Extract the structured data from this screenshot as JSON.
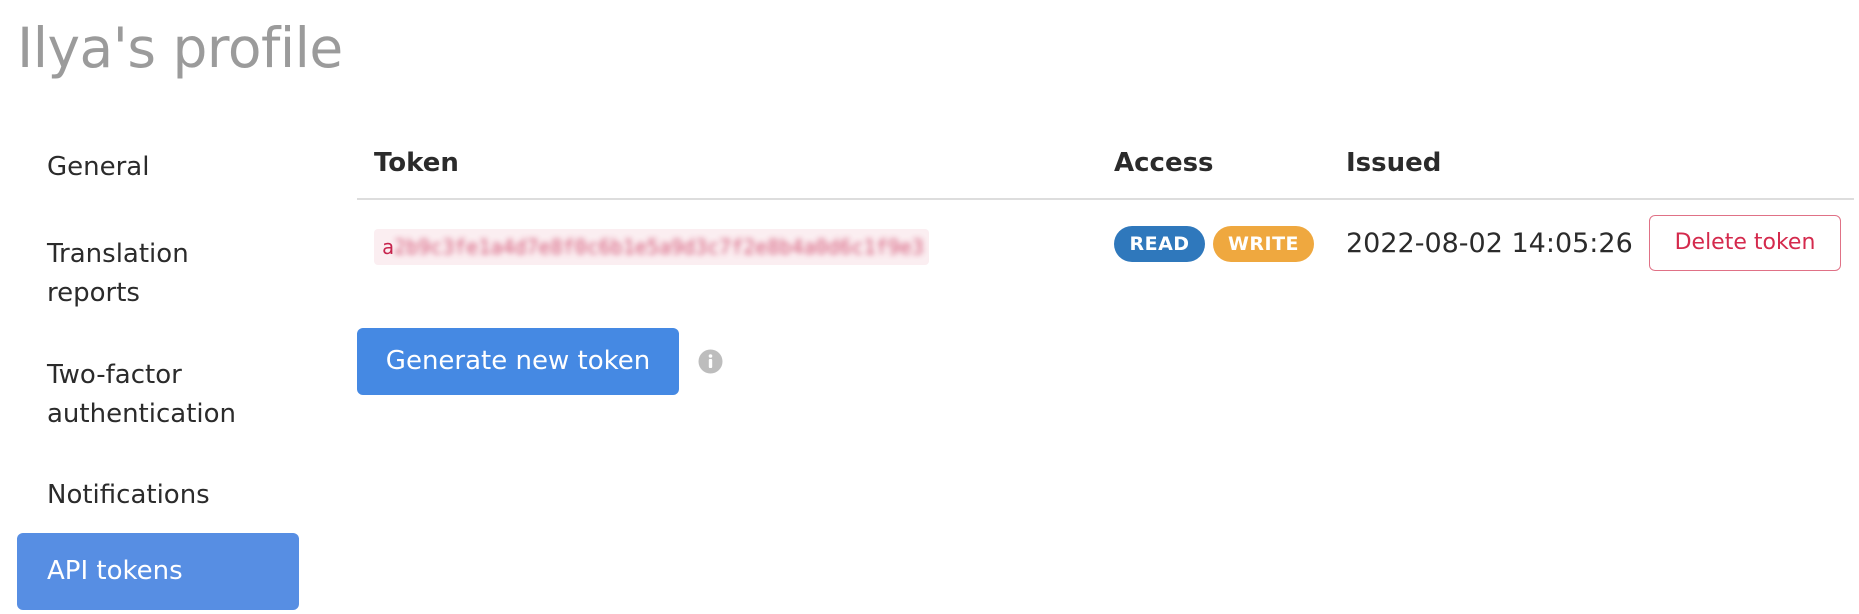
{
  "page": {
    "title": "Ilya's profile"
  },
  "sidebar": {
    "items": [
      {
        "label": "General",
        "active": false
      },
      {
        "label": "Translation reports",
        "active": false
      },
      {
        "label": "Two-factor authentication",
        "active": false
      },
      {
        "label": "Notifications",
        "active": false
      },
      {
        "label": "API tokens",
        "active": true
      }
    ],
    "active_color": "#578ee3"
  },
  "tokens_table": {
    "columns": [
      "Token",
      "Access",
      "Issued"
    ],
    "rows": [
      {
        "token_first": "a",
        "token_rest": "2b9c3fe1a4d7e8f0c6b1e5a9d3c7f2e8b4a0d6c1f9e3",
        "access": [
          "READ",
          "WRITE"
        ],
        "issued": "2022-08-02 14:05:26",
        "delete_label": "Delete token"
      }
    ]
  },
  "actions": {
    "generate_label": "Generate new token",
    "info_icon": "info-circle-icon"
  },
  "colors": {
    "read_badge": "#2f78bc",
    "write_badge": "#efa83f",
    "primary_button": "#4589e3",
    "danger": "#d42a4d",
    "token_text": "#c7254e"
  }
}
